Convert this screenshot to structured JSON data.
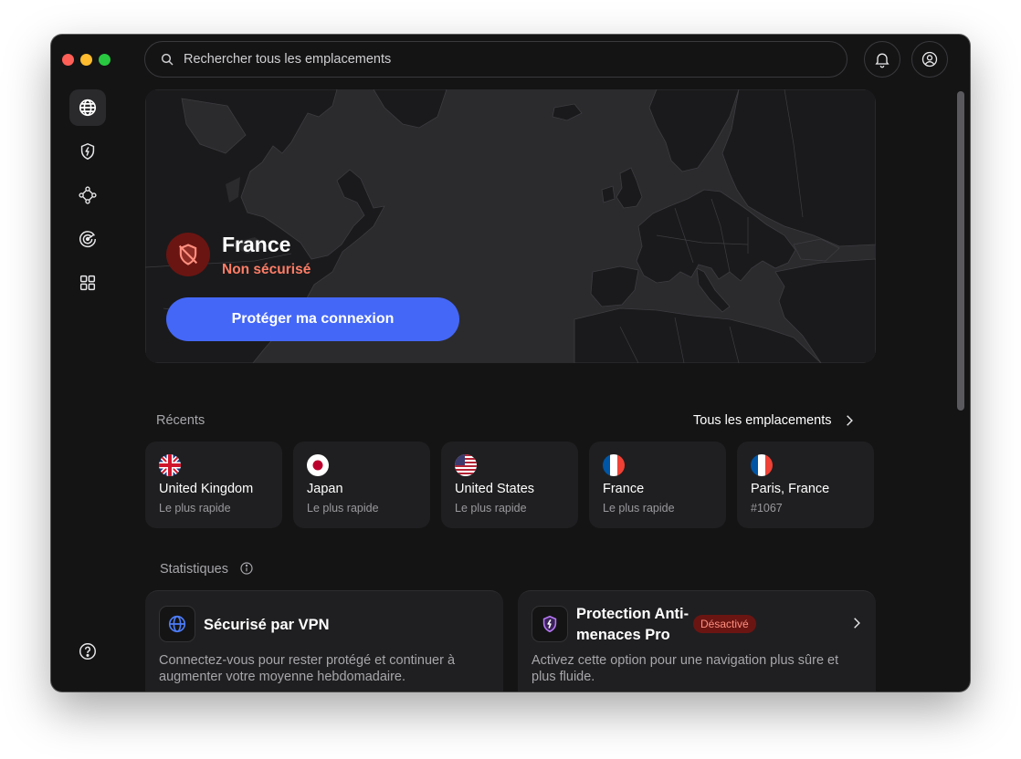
{
  "search": {
    "placeholder": "Rechercher tous les emplacements"
  },
  "sidebar": {
    "items": [
      {
        "name": "globe-icon",
        "active": true
      },
      {
        "name": "shield-bolt-icon",
        "active": false
      },
      {
        "name": "mesh-icon",
        "active": false
      },
      {
        "name": "radar-icon",
        "active": false
      },
      {
        "name": "apps-grid-icon",
        "active": false
      }
    ],
    "help_icon": "help-icon"
  },
  "header": {
    "notifications_icon": "bell-icon",
    "account_icon": "user-circle-icon"
  },
  "connection": {
    "location": "France",
    "status": "Non sécurisé",
    "status_color": "#ff7d66",
    "button_label": "Protéger ma connexion",
    "button_color": "#4467f7"
  },
  "recents": {
    "title": "Récents",
    "all_link": "Tous les emplacements",
    "items": [
      {
        "name": "United Kingdom",
        "sub": "Le plus rapide",
        "flag": "uk-flag"
      },
      {
        "name": "Japan",
        "sub": "Le plus rapide",
        "flag": "japan-flag"
      },
      {
        "name": "United States",
        "sub": "Le plus rapide",
        "flag": "us-flag"
      },
      {
        "name": "France",
        "sub": "Le plus rapide",
        "flag": "france-flag"
      },
      {
        "name": "Paris, France",
        "sub": "#1067",
        "flag": "france-flag"
      }
    ]
  },
  "stats": {
    "title": "Statistiques",
    "cards": [
      {
        "title": "Sécurisé par VPN",
        "desc": "Connectez-vous pour rester protégé et continuer à augmenter votre moyenne hebdomadaire."
      },
      {
        "title_line1": "Protection Anti-",
        "title_line2": "menaces Pro",
        "badge": "Désactivé",
        "desc": "Activez cette option pour une navigation plus sûre et plus fluide."
      }
    ]
  }
}
